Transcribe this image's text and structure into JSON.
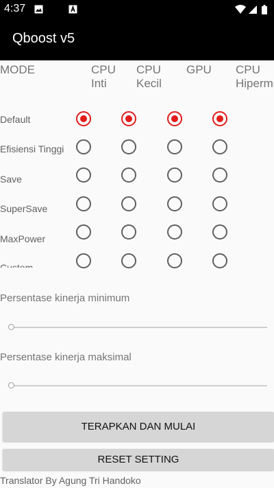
{
  "status_bar": {
    "time": "4:37",
    "icons": [
      "gallery-icon",
      "notification-icon",
      "wifi-icon",
      "signal-icon",
      "battery-icon"
    ]
  },
  "app_bar": {
    "title": "Qboost v5"
  },
  "table": {
    "columns": [
      "MODE",
      "CPU Inti",
      "CPU Kecil",
      "GPU",
      "CPU Hipermuklir"
    ],
    "rows": [
      {
        "label": "Default",
        "selected": [
          true,
          true,
          true,
          true
        ]
      },
      {
        "label": "Efisiensi Tinggi",
        "selected": [
          false,
          false,
          false,
          false
        ]
      },
      {
        "label": "Save",
        "selected": [
          false,
          false,
          false,
          false
        ]
      },
      {
        "label": "SuperSave",
        "selected": [
          false,
          false,
          false,
          false
        ]
      },
      {
        "label": "MaxPower",
        "selected": [
          false,
          false,
          false,
          false
        ]
      },
      {
        "label": "Custom",
        "selected": [
          false,
          false,
          false,
          false
        ]
      }
    ]
  },
  "min_performance": {
    "label": "Persentase kinerja minimum",
    "value": 0
  },
  "max_performance": {
    "label": "Persentase kinerja maksimal",
    "value": 0
  },
  "buttons": {
    "apply": "TERAPKAN DAN MULAI",
    "reset": "RESET SETTING"
  },
  "footer": {
    "credit": "Translator By Agung Tri Handoko"
  },
  "colors": {
    "accent": "#e21b1b",
    "app_bar": "#000000",
    "background": "#fafafa"
  }
}
